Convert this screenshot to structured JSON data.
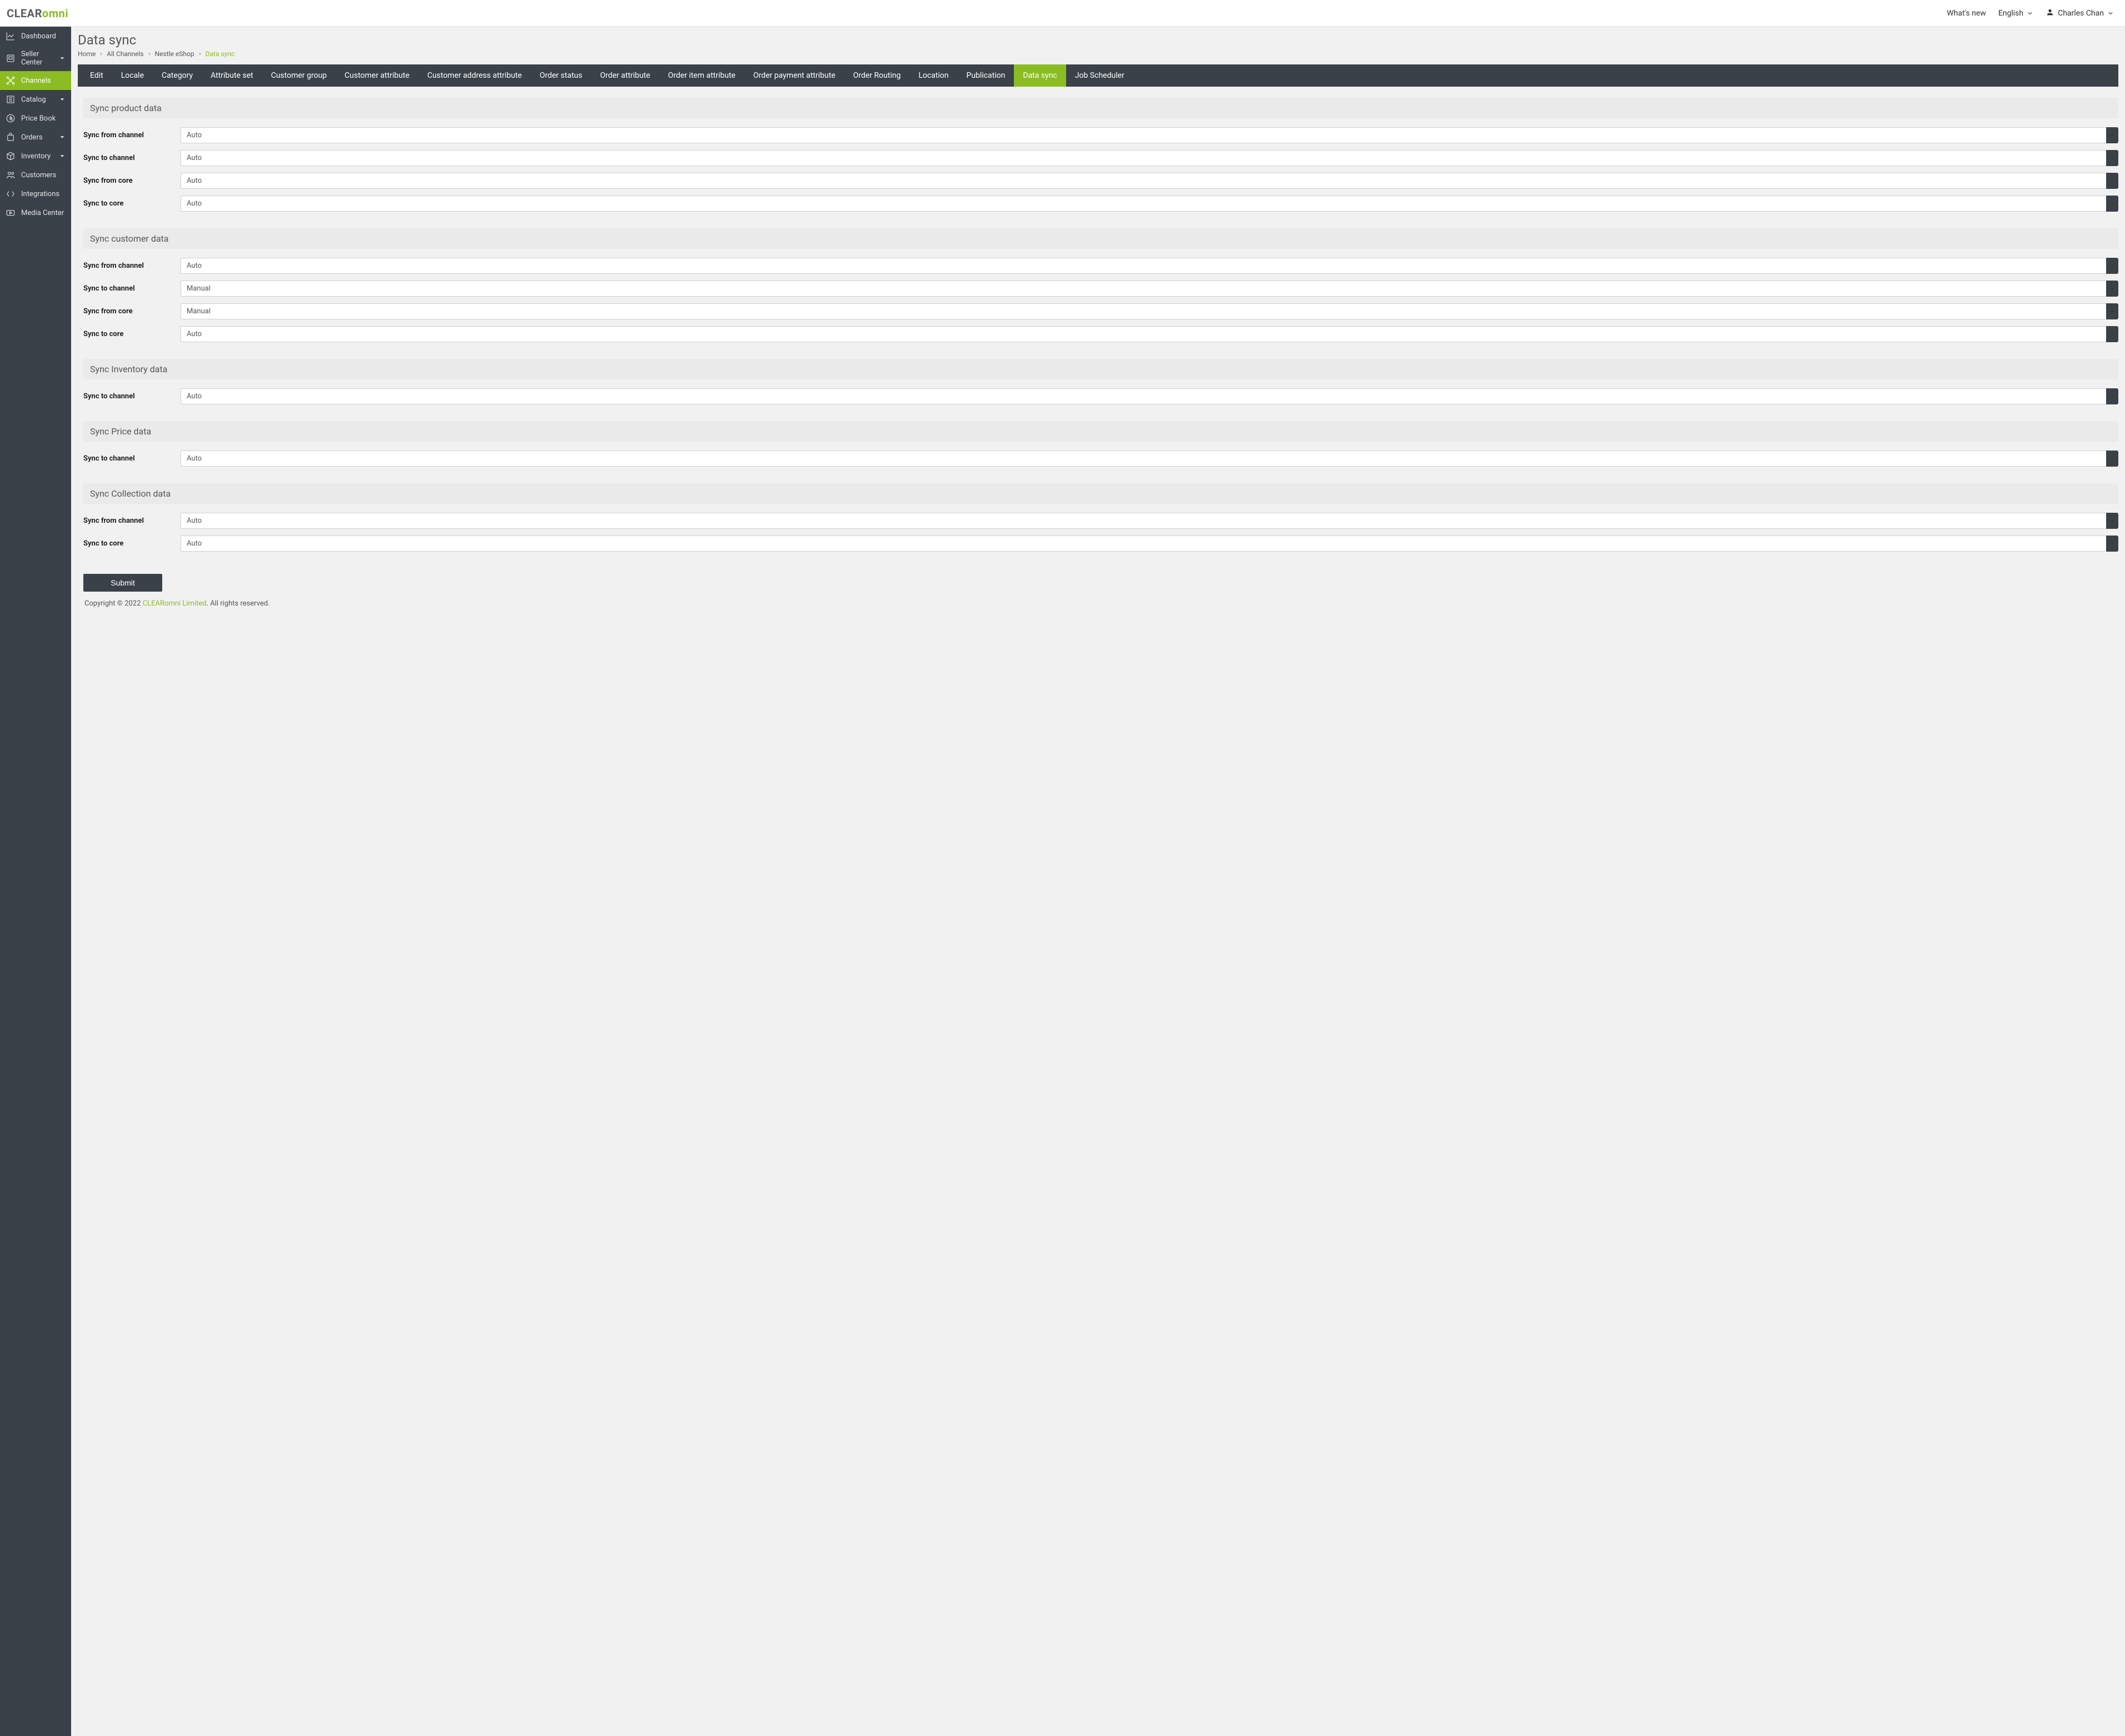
{
  "brand": {
    "clear": "CLEAR",
    "omni": "omni"
  },
  "header": {
    "whats_new": "What's new",
    "language": "English",
    "user": "Charles Chan"
  },
  "sidebar": {
    "items": [
      {
        "label": "Dashboard",
        "icon": "chart-icon",
        "expandable": false
      },
      {
        "label": "Seller Center",
        "icon": "seller-icon",
        "expandable": true
      },
      {
        "label": "Channels",
        "icon": "channels-icon",
        "expandable": false,
        "active": true
      },
      {
        "label": "Catalog",
        "icon": "catalog-icon",
        "expandable": true
      },
      {
        "label": "Price Book",
        "icon": "price-icon",
        "expandable": false
      },
      {
        "label": "Orders",
        "icon": "orders-icon",
        "expandable": true
      },
      {
        "label": "Inventory",
        "icon": "inventory-icon",
        "expandable": true
      },
      {
        "label": "Customers",
        "icon": "customers-icon",
        "expandable": false
      },
      {
        "label": "Integrations",
        "icon": "integrations-icon",
        "expandable": false
      },
      {
        "label": "Media Center",
        "icon": "media-icon",
        "expandable": false
      }
    ]
  },
  "page": {
    "title": "Data sync",
    "breadcrumb": {
      "home": "Home",
      "all_channels": "All Channels",
      "channel": "Nestle eShop",
      "current": "Data sync"
    }
  },
  "tabs": [
    "Edit",
    "Locale",
    "Category",
    "Attribute set",
    "Customer group",
    "Customer attribute",
    "Customer address attribute",
    "Order status",
    "Order attribute",
    "Order item attribute",
    "Order payment attribute",
    "Order Routing",
    "Location",
    "Publication",
    "Data sync",
    "Job Scheduler"
  ],
  "active_tab": "Data sync",
  "sections": [
    {
      "title": "Sync product data",
      "rows": [
        {
          "label": "Sync from channel",
          "value": "Auto"
        },
        {
          "label": "Sync to channel",
          "value": "Auto"
        },
        {
          "label": "Sync from core",
          "value": "Auto"
        },
        {
          "label": "Sync to core",
          "value": "Auto"
        }
      ]
    },
    {
      "title": "Sync customer data",
      "rows": [
        {
          "label": "Sync from channel",
          "value": "Auto"
        },
        {
          "label": "Sync to channel",
          "value": "Manual"
        },
        {
          "label": "Sync from core",
          "value": "Manual"
        },
        {
          "label": "Sync to core",
          "value": "Auto"
        }
      ]
    },
    {
      "title": "Sync Inventory data",
      "rows": [
        {
          "label": "Sync to channel",
          "value": "Auto"
        }
      ]
    },
    {
      "title": "Sync Price data",
      "rows": [
        {
          "label": "Sync to channel",
          "value": "Auto"
        }
      ]
    },
    {
      "title": "Sync Collection data",
      "rows": [
        {
          "label": "Sync from channel",
          "value": "Auto"
        },
        {
          "label": "Sync to core",
          "value": "Auto"
        }
      ]
    }
  ],
  "submit_label": "Submit",
  "footer": {
    "copyright": "Copyright © 2022 ",
    "brand": "CLEARomni Limited",
    "rights": ". All rights reserved."
  }
}
